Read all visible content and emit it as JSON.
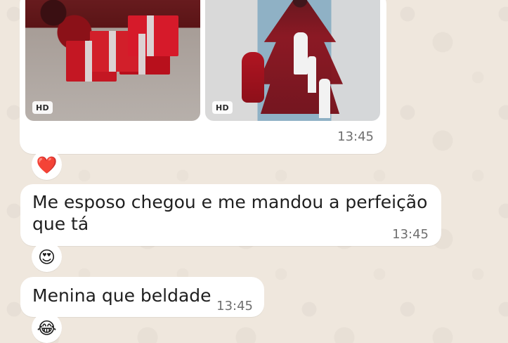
{
  "messages": [
    {
      "time": "13:45",
      "badges": [
        "HD",
        "HD"
      ],
      "reaction": "❤️"
    },
    {
      "text": "Me esposo chegou e me mandou a perfeição que tá",
      "time": "13:45",
      "reaction": "😍"
    },
    {
      "text": "Menina que beldade",
      "time": "13:45",
      "reaction": "😂"
    }
  ]
}
